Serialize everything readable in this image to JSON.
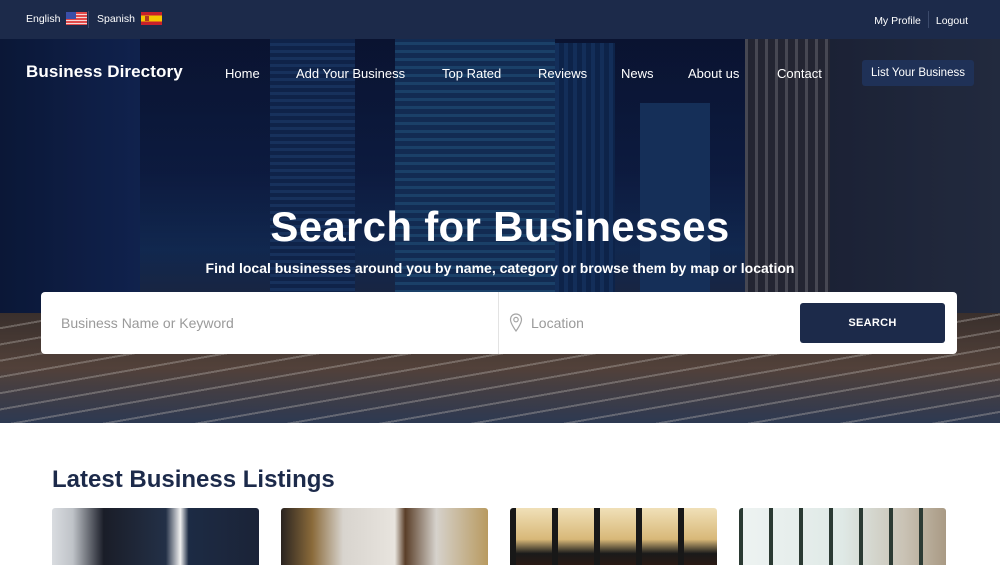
{
  "topbar": {
    "languages": [
      {
        "label": "English",
        "flag": "us-flag-icon"
      },
      {
        "label": "Spanish",
        "flag": "spain-flag-icon"
      }
    ],
    "links": [
      {
        "label": "My Profile"
      },
      {
        "label": "Logout"
      }
    ]
  },
  "header": {
    "brand": "Business Directory",
    "nav": [
      {
        "label": "Home"
      },
      {
        "label": "Add Your Business"
      },
      {
        "label": "Top Rated"
      },
      {
        "label": "Reviews"
      },
      {
        "label": "News"
      },
      {
        "label": "About us"
      },
      {
        "label": "Contact"
      }
    ],
    "cta_label": "List Your Business"
  },
  "hero": {
    "title": "Search for Businesses",
    "subtitle": "Find local businesses around you by name, category or browse them by map or location"
  },
  "search": {
    "keyword_placeholder": "Business Name or Keyword",
    "keyword_value": "",
    "location_placeholder": "Location",
    "location_value": "",
    "location_icon": "map-pin-icon",
    "button_label": "SEARCH"
  },
  "listings": {
    "title": "Latest Business Listings",
    "cards": [
      {
        "image": "businessman-at-desk"
      },
      {
        "image": "luxury-interior"
      },
      {
        "image": "restaurant-night"
      },
      {
        "image": "gym-treadmills"
      }
    ]
  },
  "colors": {
    "navy": "#1c2a4a",
    "cta_bg": "#1f3157",
    "white": "#ffffff",
    "placeholder": "#9a9a9a"
  }
}
